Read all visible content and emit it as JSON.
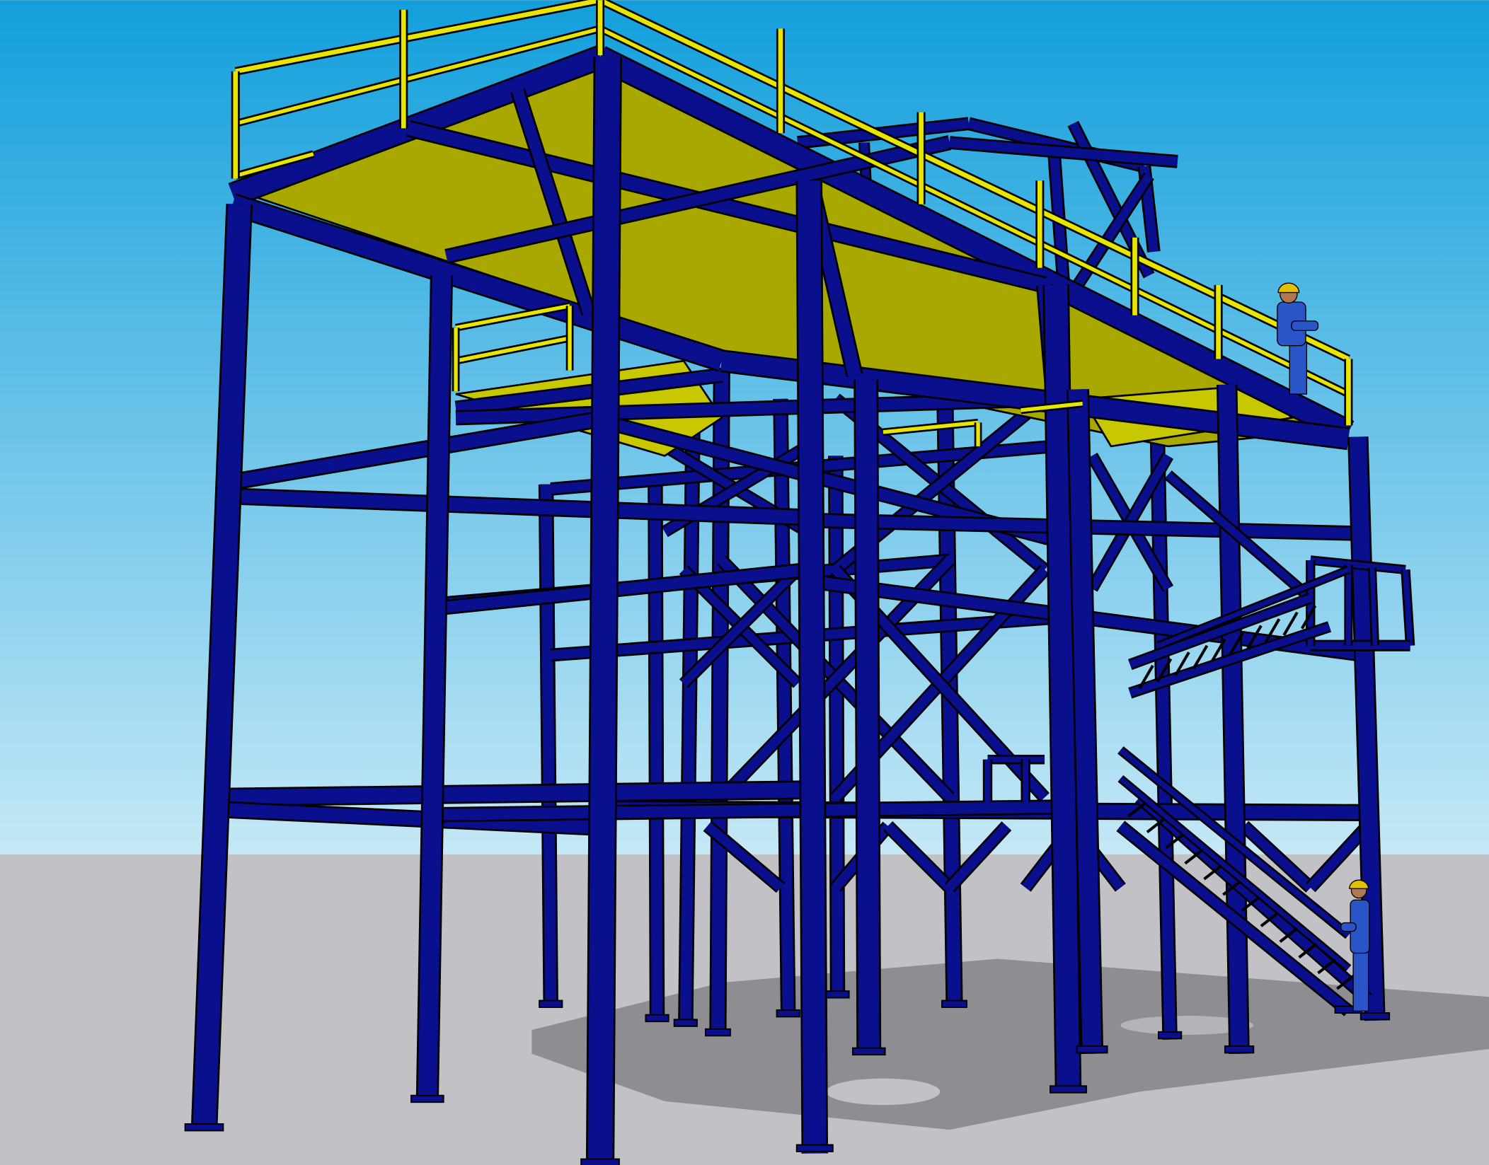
{
  "scene": {
    "colors": {
      "sky_top": "#129fdc",
      "sky_horizon": "#c4e8f6",
      "ground": "#c2c2c6",
      "shadow": "#8e8e92",
      "steel": "#0a0f8e",
      "steel_outline": "#000000",
      "deck": "#a8a800",
      "deck_light": "#c8c800",
      "railing": "#e6e600",
      "worker_suit": "#2a55c8",
      "worker_helmet": "#e0c000",
      "worker_skin": "#b07850"
    }
  }
}
